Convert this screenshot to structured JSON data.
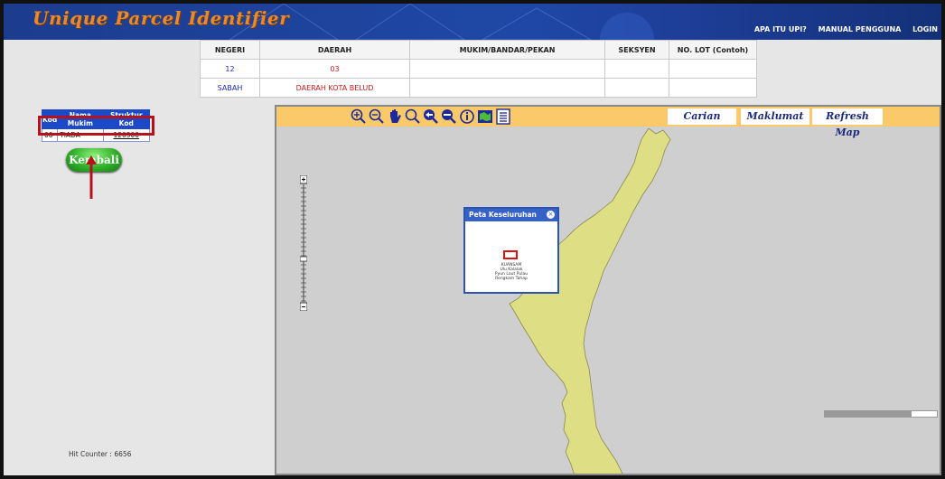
{
  "header": {
    "title": "Unique Parcel Identifier",
    "nav": [
      "APA ITU UPI?",
      "MANUAL PENGGUNA",
      "LOGIN"
    ]
  },
  "info_table": {
    "headers": [
      "NEGERI",
      "DAERAH",
      "MUKIM/BANDAR/PEKAN",
      "SEKSYEN",
      "NO. LOT (Contoh)"
    ],
    "codes": [
      "12",
      "03",
      "",
      "",
      ""
    ],
    "names": [
      "SABAH",
      "DAERAH KOTA BELUD",
      "",
      "",
      ""
    ]
  },
  "mukim_table": {
    "headers": [
      "Kod",
      "Nama Mukim",
      "Struktur Kod"
    ],
    "rows": [
      [
        "00",
        "TIADA",
        "120300"
      ]
    ]
  },
  "kembali_button": "Kembali",
  "hit_counter": "Hit Counter : 6656",
  "map": {
    "tabs": [
      "Carian",
      "Maklumat",
      "Refresh Map"
    ],
    "tools": [
      "zoom-in-icon",
      "zoom-out-icon",
      "pan-hand-icon",
      "zoom-box-icon",
      "previous-extent-icon",
      "next-extent-icon",
      "info-icon",
      "full-extent-map-icon",
      "legend-icon"
    ],
    "overview": {
      "title": "Peta Keseluruhan",
      "labels": [
        "KUANSAM",
        "Ulu Kalalak",
        "Pyun Laut Pulau",
        "Rengkam Tahap"
      ]
    },
    "colors": {
      "land": "#dede84",
      "toolbar": "#f9c96a",
      "overview_header": "#3562c8"
    }
  }
}
